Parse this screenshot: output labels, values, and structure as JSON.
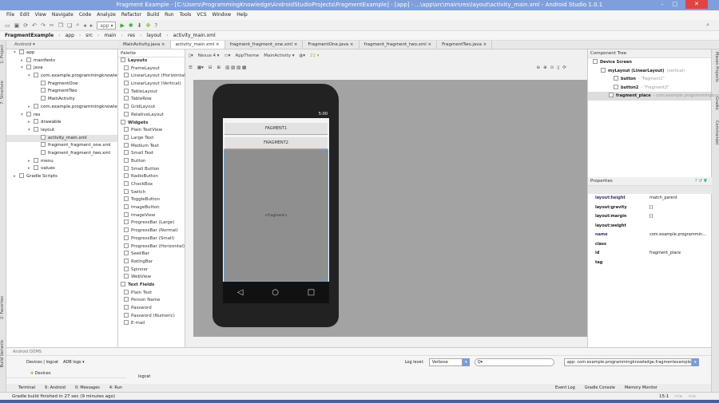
{
  "window": {
    "title": "Fragment Example - [C:\\Users\\ProgrammingKnowledge\\AndroidStudioProjects\\FragmentExample] - [app] - ...\\app\\src\\main\\res\\layout\\activity_main.xml - Android Studio 1.0.1",
    "minimize": "–",
    "maximize": "□",
    "close": "✕"
  },
  "menu": [
    "File",
    "Edit",
    "View",
    "Navigate",
    "Code",
    "Analyze",
    "Refactor",
    "Build",
    "Run",
    "Tools",
    "VCS",
    "Window",
    "Help"
  ],
  "toolbar": {
    "run_config": "app ▾",
    "help": "?"
  },
  "breadcrumb": [
    "FragmentExample",
    "app",
    "src",
    "main",
    "res",
    "layout",
    "activity_main.xml"
  ],
  "project_panel": {
    "view": "Android ▾"
  },
  "editor_tabs": [
    {
      "label": "MainActivity.java ×",
      "active": false
    },
    {
      "label": "activity_main.xml ×",
      "active": true
    },
    {
      "label": "fragment_fragment_one.xml ×",
      "active": false
    },
    {
      "label": "FragmentOne.java ×",
      "active": false
    },
    {
      "label": "fragment_fragment_two.xml ×",
      "active": false
    },
    {
      "label": "FragmentTwo.java ×",
      "active": false
    }
  ],
  "project_tree": [
    {
      "label": "app",
      "indent": 1,
      "arrow": "▾"
    },
    {
      "label": "manifests",
      "indent": 2,
      "arrow": "▸"
    },
    {
      "label": "java",
      "indent": 2,
      "arrow": "▾"
    },
    {
      "label": "com.example.programmingknowledge",
      "indent": 3,
      "arrow": "▾"
    },
    {
      "label": "FragmentOne",
      "indent": 4,
      "arrow": ""
    },
    {
      "label": "FragmentTwo",
      "indent": 4,
      "arrow": ""
    },
    {
      "label": "MainActivity",
      "indent": 4,
      "arrow": ""
    },
    {
      "label": "com.example.programmingknowle",
      "indent": 3,
      "arrow": "▸"
    },
    {
      "label": "res",
      "indent": 2,
      "arrow": "▾"
    },
    {
      "label": "drawable",
      "indent": 3,
      "arrow": "▸"
    },
    {
      "label": "layout",
      "indent": 3,
      "arrow": "▾"
    },
    {
      "label": "activity_main.xml",
      "indent": 4,
      "arrow": "",
      "selected": true
    },
    {
      "label": "fragment_fragment_one.xml",
      "indent": 4,
      "arrow": ""
    },
    {
      "label": "fragment_fragment_two.xml",
      "indent": 4,
      "arrow": ""
    },
    {
      "label": "menu",
      "indent": 3,
      "arrow": "▸"
    },
    {
      "label": "values",
      "indent": 3,
      "arrow": "▸"
    },
    {
      "label": "Gradle Scripts",
      "indent": 1,
      "arrow": "▸"
    }
  ],
  "side_tabs": {
    "project": "1: Project",
    "structure": "7: Structure",
    "favorites": "2: Favorites",
    "build_variants": "Build Variants",
    "maven": "Maven Projects",
    "gradle": "Gradle",
    "commander": "Commander"
  },
  "palette": {
    "title": "Palette",
    "groups": [
      {
        "name": "Layouts",
        "items": [
          "FrameLayout",
          "LinearLayout (Horizontal)",
          "LinearLayout (Vertical)",
          "TableLayout",
          "TableRow",
          "GridLayout",
          "RelativeLayout"
        ]
      },
      {
        "name": "Widgets",
        "items": [
          "Plain TextView",
          "Large Text",
          "Medium Text",
          "Small Text",
          "Button",
          "Small Button",
          "RadioButton",
          "CheckBox",
          "Switch",
          "ToggleButton",
          "ImageButton",
          "ImageView",
          "ProgressBar (Large)",
          "ProgressBar (Normal)",
          "ProgressBar (Small)",
          "ProgressBar (Horizontal)",
          "SeekBar",
          "RatingBar",
          "Spinner",
          "WebView"
        ]
      },
      {
        "name": "Text Fields",
        "items": [
          "Plain Text",
          "Person Name",
          "Password",
          "Password (Numeric)",
          "E-mail"
        ]
      }
    ]
  },
  "design_toolbar": {
    "device": "Nexus 4 ▾",
    "theme": "AppTheme",
    "activity": "MainActivity ▾",
    "api": "21 ▾"
  },
  "device": {
    "time": "5:00",
    "button1": "FAGMENT1",
    "button2": "FRAGMENT2",
    "fragment_label": "<fragment>"
  },
  "component_tree": {
    "title": "Component Tree",
    "items": [
      {
        "label": "Device Screen",
        "detail": ""
      },
      {
        "label": "myLayout (LinearLayout)",
        "detail": "(vertical)"
      },
      {
        "label": "button",
        "detail": "- \"Fagment1\""
      },
      {
        "label": "button2",
        "detail": "- \"Fragment2\""
      },
      {
        "label": "fragment_place",
        "detail": "- com.example.programmingknowledge"
      }
    ]
  },
  "properties": {
    "title": "Properties",
    "rows": [
      {
        "name": "layout:height",
        "value": "match_parent"
      },
      {
        "name": "layout:gravity",
        "value": "[]"
      },
      {
        "name": "layout:margin",
        "value": "[]"
      },
      {
        "name": "layout:weight",
        "value": ""
      },
      {
        "name": "name",
        "value": "com.example.programmin..."
      },
      {
        "name": "class",
        "value": ""
      },
      {
        "name": "id",
        "value": "fragment_place"
      },
      {
        "name": "tag",
        "value": ""
      }
    ]
  },
  "ddms": {
    "title": "Android DDMS",
    "tab": "Devices | logcat",
    "adb_logs": "ADB logs ▾",
    "devices": "Devices",
    "logcat": "logcat",
    "log_level_label": "Log level:",
    "log_level": "Verbose",
    "search_placeholder": "Q▾",
    "app_filter": "app: com.example.programmingknowledge.fragmentexample"
  },
  "bottom_tabs": [
    "Terminal",
    "6: Android",
    "0: Messages",
    "4: Run"
  ],
  "bottom_right_tabs": [
    "Event Log",
    "Gradle Console",
    "Memory Monitor"
  ],
  "status": {
    "message": "Gradle build finished in 27 sec (9 minutes ago)",
    "position": "15:1",
    "na1": "n/a",
    "na2": "n/a"
  }
}
